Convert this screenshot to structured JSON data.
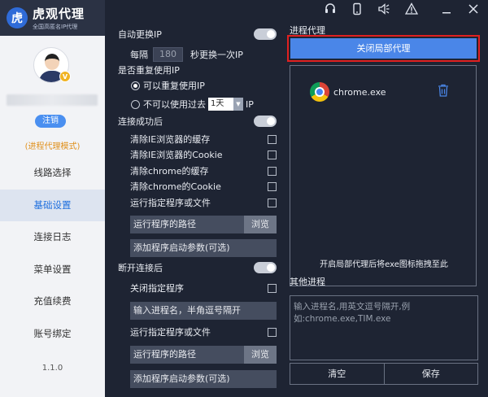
{
  "brand": {
    "title": "虎观代理",
    "subtitle": "全国高匿名IP代理",
    "vip": "V"
  },
  "sidebar": {
    "logout_label": "注销",
    "mode_label": "(进程代理模式)",
    "items": [
      {
        "label": "线路选择",
        "active": false
      },
      {
        "label": "基础设置",
        "active": true
      },
      {
        "label": "连接日志",
        "active": false
      },
      {
        "label": "菜单设置",
        "active": false
      },
      {
        "label": "充值续费",
        "active": false
      },
      {
        "label": "账号绑定",
        "active": false
      }
    ],
    "version": "1.1.0"
  },
  "topbar_icons": [
    "headset-icon",
    "phone-icon",
    "speaker-icon",
    "warning-icon",
    "minimize-icon",
    "close-icon"
  ],
  "settings": {
    "auto_switch_label": "自动更换IP",
    "every_label": "每隔",
    "interval_value": "180",
    "interval_suffix": "秒更换一次IP",
    "reuse_label": "是否重复使用IP",
    "reuse_option": "可以重复使用IP",
    "no_reuse_prefix": "不可以使用过去",
    "no_reuse_value": "1天",
    "no_reuse_suffix": "IP",
    "on_connect_label": "连接成功后",
    "connect_options": [
      "清除IE浏览器的缓存",
      "清除IE浏览器的Cookie",
      "清除chrome的缓存",
      "清除chrome的Cookie",
      "运行指定程序或文件"
    ],
    "program_path": "运行程序的路径",
    "browse": "浏览",
    "add_params": "添加程序启动参数(可选)",
    "on_disconnect_label": "断开连接后",
    "close_program": "关闭指定程序",
    "process_name_hint": "输入进程名，半角逗号隔开",
    "run_program": "运行指定程序或文件",
    "program_path2": "运行程序的路径",
    "browse2": "浏览",
    "add_params2": "添加程序启动参数(可选)"
  },
  "proxy": {
    "section_title": "进程代理",
    "close_button": "关闭局部代理",
    "process": "chrome.exe",
    "drop_hint": "开启局部代理后将exe图标拖拽至此",
    "other_title": "其他进程",
    "other_placeholder_1": "输入进程名,用英文逗号隔开,例",
    "other_placeholder_2": "如:chrome.exe,TIM.exe",
    "clear_button": "清空",
    "save_button": "保存"
  },
  "colors": {
    "accent": "#4a86e8",
    "highlight": "#e02020",
    "mode": "#e0901c",
    "panel": "#1e2433"
  }
}
